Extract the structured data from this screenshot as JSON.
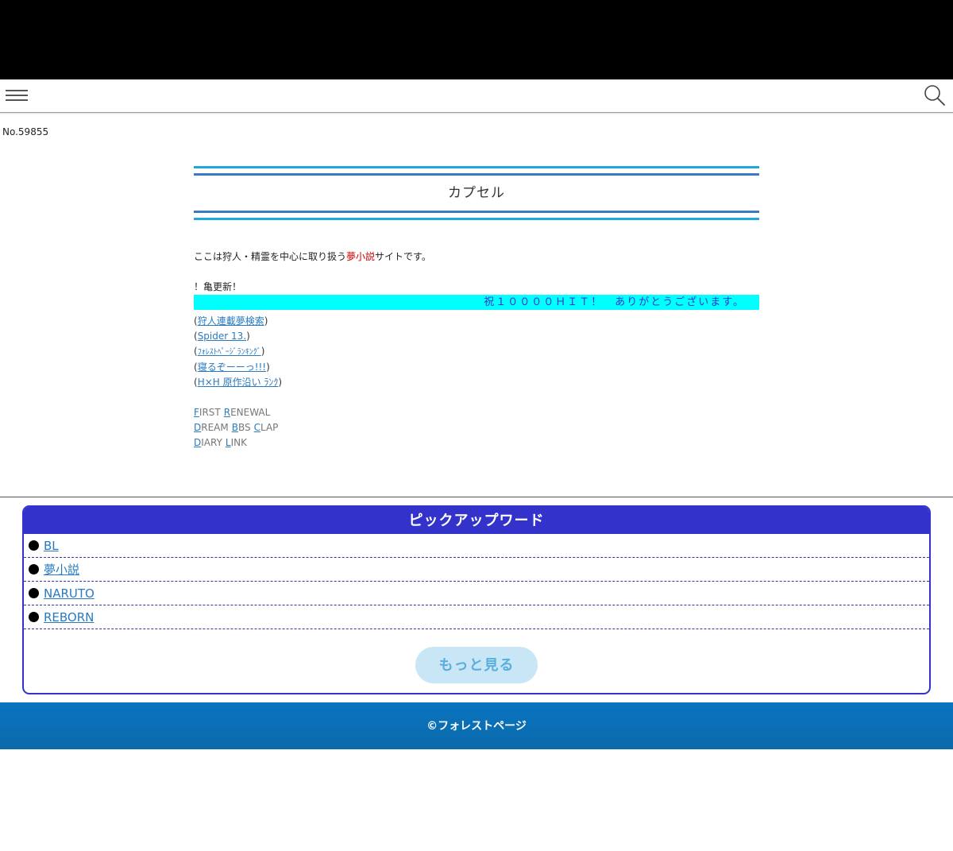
{
  "header": {
    "menu_icon": "hamburger-icon",
    "search_icon": "search-icon"
  },
  "page": {
    "number": "No.59855"
  },
  "site": {
    "title": "カプセル",
    "intro_before": "ここは狩人・精霊を中心に取り扱う",
    "intro_highlight": "夢小説",
    "intro_after": "サイトです。",
    "notice": "！亀更新！",
    "banner": "祝１００００ＨＩＴ！　ありがとうございます。"
  },
  "links": [
    {
      "label": "狩人連載夢検索"
    },
    {
      "label": "Spider 13."
    },
    {
      "label": "ﾌｫﾚｽﾄﾍﾟｰｼﾞﾗﾝｷﾝｸﾞ"
    },
    {
      "label": "寝るぞーーっ!!!"
    },
    {
      "label": "H×H 原作沿い ﾗﾝｸ"
    }
  ],
  "menu": {
    "rows": [
      [
        {
          "ini": "F",
          "rest": "IRST"
        },
        {
          "ini": "R",
          "rest": "ENEWAL"
        }
      ],
      [
        {
          "ini": "D",
          "rest": "REAM"
        },
        {
          "ini": "B",
          "rest": "BS"
        },
        {
          "ini": "C",
          "rest": "LAP"
        }
      ],
      [
        {
          "ini": "D",
          "rest": "IARY"
        },
        {
          "ini": "L",
          "rest": "INK"
        }
      ]
    ]
  },
  "pickup": {
    "title": "ピックアップワード",
    "words": [
      "BL",
      "夢小説",
      "NARUTO",
      "REBORN"
    ],
    "more_label": "もっと見る"
  },
  "footer": {
    "copyright": "©フォレストページ"
  },
  "colors": {
    "title_rule_light": "#1fa6e3",
    "title_rule_dark": "#3a79c6",
    "banner_bg": "#00ffff",
    "banner_text": "#3333cc",
    "pickup_accent": "#3333cc",
    "link": "#2a7ac0",
    "footer_bg": "#0a74bf"
  }
}
